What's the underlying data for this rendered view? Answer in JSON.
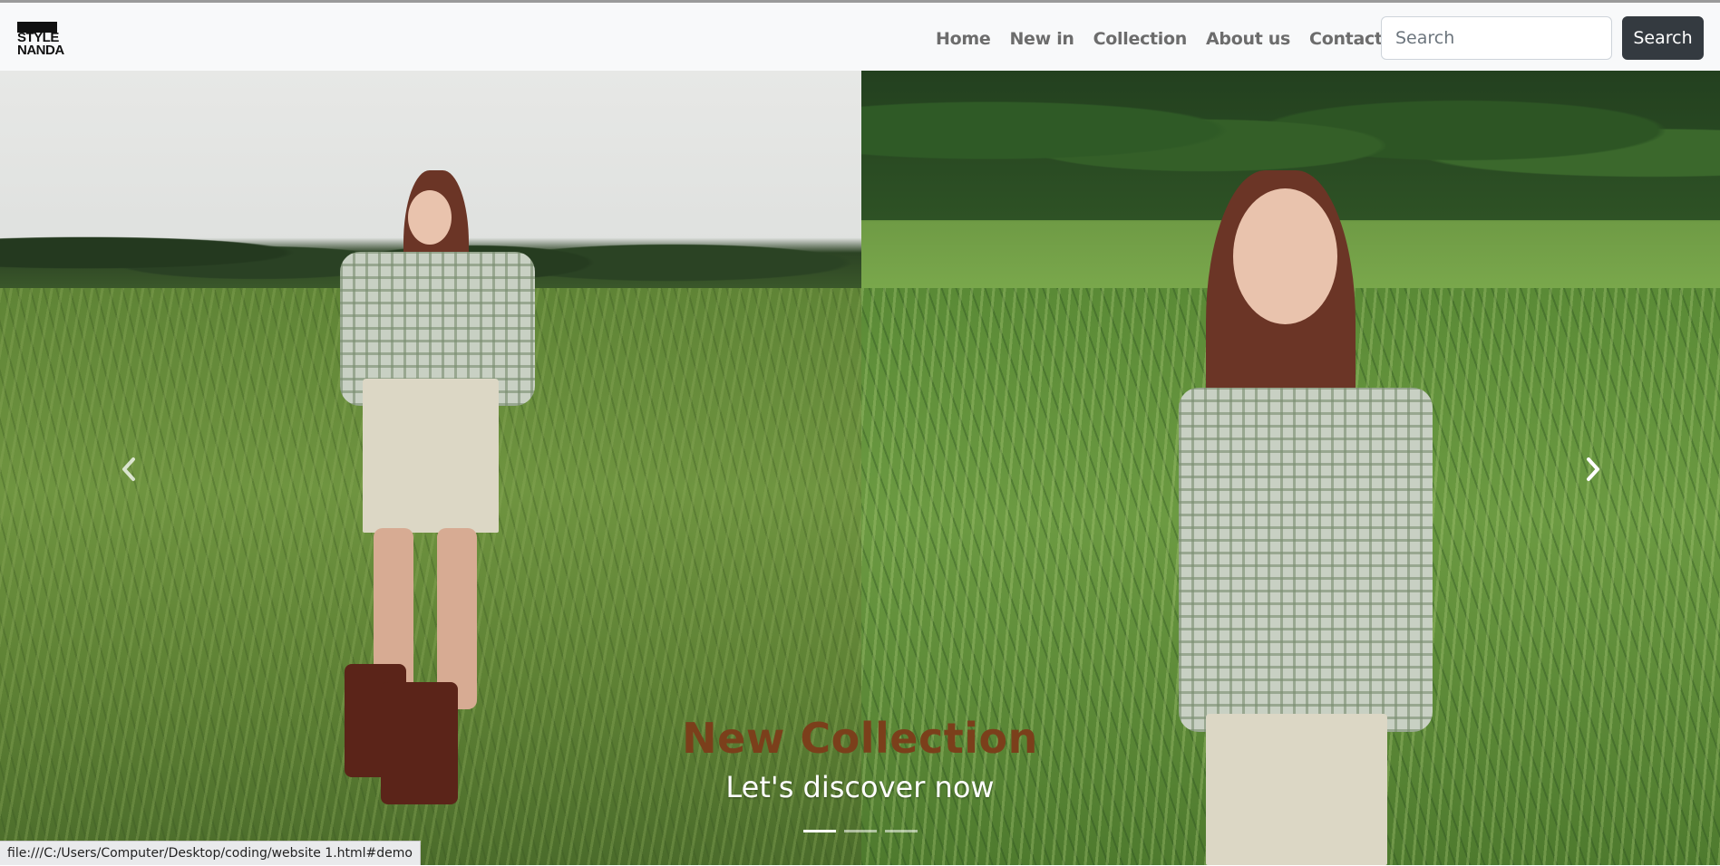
{
  "brand": {
    "logo_text": "STYLE\nNANDA"
  },
  "nav": {
    "links": [
      "Home",
      "New in",
      "Collection",
      "About us",
      "Contact us"
    ]
  },
  "search": {
    "placeholder": "Search",
    "button_label": "Search"
  },
  "carousel": {
    "caption_title": "New Collection",
    "caption_subtitle": "Let's discover now",
    "slide_count": 3,
    "active_index": 0,
    "prev_icon": "chevron-left-icon",
    "next_icon": "chevron-right-icon"
  },
  "statusbar": {
    "url": "file:///C:/Users/Computer/Desktop/coding/website 1.html#demo"
  },
  "colors": {
    "caption_title": "#7b3f1b",
    "navbar_bg": "#f8f9fa",
    "search_btn": "#343a40"
  }
}
